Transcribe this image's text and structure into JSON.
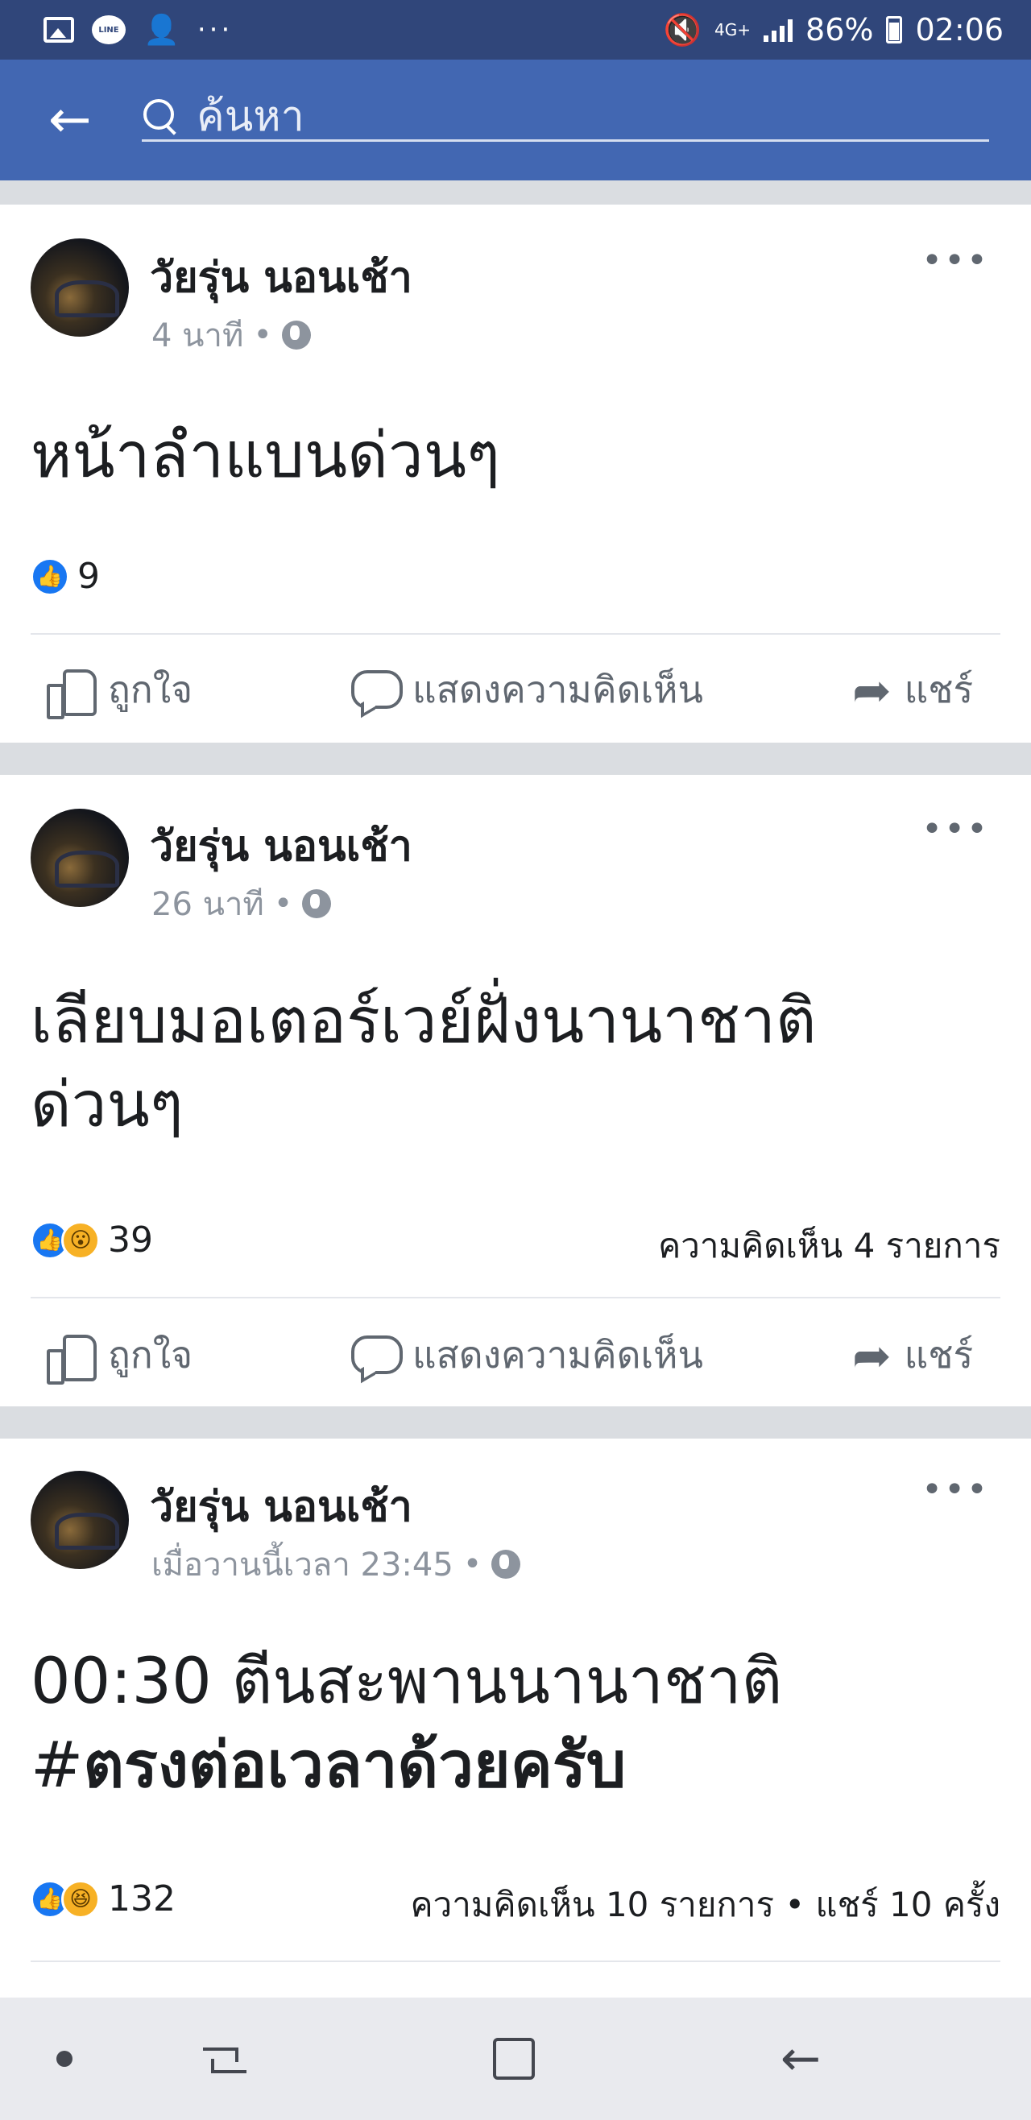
{
  "status_bar": {
    "battery": "86%",
    "time": "02:06",
    "network": "4G+",
    "line_label": "LINE",
    "icons": [
      "image-icon",
      "line-icon",
      "add-user-icon",
      "more-notifications-icon",
      "mute-icon",
      "signal-icon",
      "battery-icon"
    ]
  },
  "header": {
    "back_icon": "back-arrow-icon",
    "search_placeholder": "ค้นหา"
  },
  "posts": [
    {
      "author": "วัยรุ่น นอนเช้า",
      "time": "4 นาที",
      "separator": "•",
      "text_lines": [
        "หน้าลำแบนด่วนๆ"
      ],
      "reactions": [
        "like"
      ],
      "reaction_count": "9",
      "comments_summary": "",
      "actions": {
        "like": "ถูกใจ",
        "comment": "แสดงความคิดเห็น",
        "share": "แชร์"
      }
    },
    {
      "author": "วัยรุ่น นอนเช้า",
      "time": "26 นาที",
      "separator": "•",
      "text_lines": [
        "เลียบมอเตอร์เวย์ฝั่งนานาชาติ",
        "ด่วนๆ"
      ],
      "reactions": [
        "like",
        "wow"
      ],
      "reaction_count": "39",
      "comments_summary": "ความคิดเห็น 4 รายการ",
      "actions": {
        "like": "ถูกใจ",
        "comment": "แสดงความคิดเห็น",
        "share": "แชร์"
      }
    },
    {
      "author": "วัยรุ่น นอนเช้า",
      "time": "เมื่อวานนี้เวลา 23:45",
      "separator": "•",
      "text_line1": "00:30 ตีนสะพานนานาชาติ",
      "text_line2_prefix": "#",
      "text_line2_bold": "ตรงต่อเวลาด้วยครับ",
      "reactions": [
        "like",
        "haha"
      ],
      "reaction_count": "132",
      "comments_summary": "ความคิดเห็น 10 รายการ • แชร์ 10 ครั้ง"
    }
  ],
  "colors": {
    "status_bar": "#30467a",
    "header": "#4267b2",
    "like_blue": "#1877f2",
    "text_secondary": "#606770"
  }
}
